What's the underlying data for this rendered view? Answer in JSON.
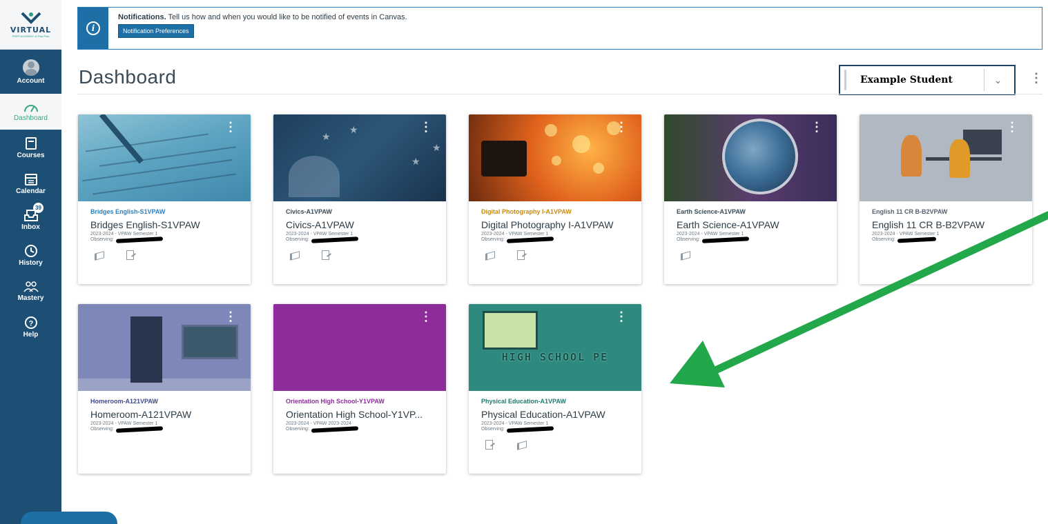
{
  "nav": {
    "logo": {
      "word": "VIRTUAL",
      "sub": "PREP ACADEMY of Paw Paw"
    },
    "items": [
      {
        "key": "account",
        "label": "Account"
      },
      {
        "key": "dashboard",
        "label": "Dashboard"
      },
      {
        "key": "courses",
        "label": "Courses"
      },
      {
        "key": "calendar",
        "label": "Calendar"
      },
      {
        "key": "inbox",
        "label": "Inbox",
        "badge": "39"
      },
      {
        "key": "history",
        "label": "History"
      },
      {
        "key": "mastery",
        "label": "Mastery"
      },
      {
        "key": "help",
        "label": "Help"
      }
    ]
  },
  "banner": {
    "title": "Notifications.",
    "text": "Tell us how and when you would like to be notified of events in Canvas.",
    "button": "Notification Preferences"
  },
  "header": {
    "title": "Dashboard",
    "student_select": "Example Student"
  },
  "courses": [
    {
      "short": "Bridges English-S1VPAW",
      "name": "Bridges English-S1VPAW",
      "term": "2023-2024 - VPAW Semester 1",
      "observing": "Observing:",
      "color": "#2d7fbf",
      "actions": [
        "megaphone",
        "assign"
      ]
    },
    {
      "short": "Civics-A1VPAW",
      "name": "Civics-A1VPAW",
      "term": "2023-2024 - VPAW Semester 1",
      "observing": "Observing:",
      "color": "#394b58",
      "actions": [
        "megaphone",
        "assign"
      ]
    },
    {
      "short": "Digital Photography I-A1VPAW",
      "name": "Digital Photography I-A1VPAW",
      "term": "2023-2024 - VPAW Semester 1",
      "observing": "Observing:",
      "color": "#c98a10",
      "actions": [
        "megaphone",
        "assign"
      ]
    },
    {
      "short": "Earth Science-A1VPAW",
      "name": "Earth Science-A1VPAW",
      "term": "2023-2024 - VPAW Semester 1",
      "observing": "Observing:",
      "color": "#394b58",
      "actions": [
        "megaphone"
      ]
    },
    {
      "short": "English 11 CR B-B2VPAW",
      "name": "English 11 CR B-B2VPAW",
      "term": "2023-2024 - VPAW Semester 1",
      "observing": "Observing:",
      "color": "#556270",
      "actions": []
    },
    {
      "short": "Homeroom-A121VPAW",
      "name": "Homeroom-A121VPAW",
      "term": "2023-2024 - VPAW Semester 1",
      "observing": "Observing:",
      "color": "#3d4a8a",
      "actions": []
    },
    {
      "short": "Orientation High School-Y1VPAW",
      "name": "Orientation High School-Y1VP...",
      "term": "2023-2024 - VPAW 2023-2024",
      "observing": "Observing:",
      "color": "#8e2c9c",
      "actions": []
    },
    {
      "short": "Physical Education-A1VPAW",
      "name": "Physical Education-A1VPAW",
      "term": "2023-2024 - VPAW Semester 1",
      "observing": "Observing:",
      "color": "#1f7a6e",
      "actions": [
        "assign",
        "megaphone"
      ]
    }
  ],
  "pe_hero_text": "HIGH SCHOOL PE",
  "colors": {
    "nav": "#1d4f75",
    "accent": "#1d6fa5",
    "arrow": "#22a84a"
  }
}
